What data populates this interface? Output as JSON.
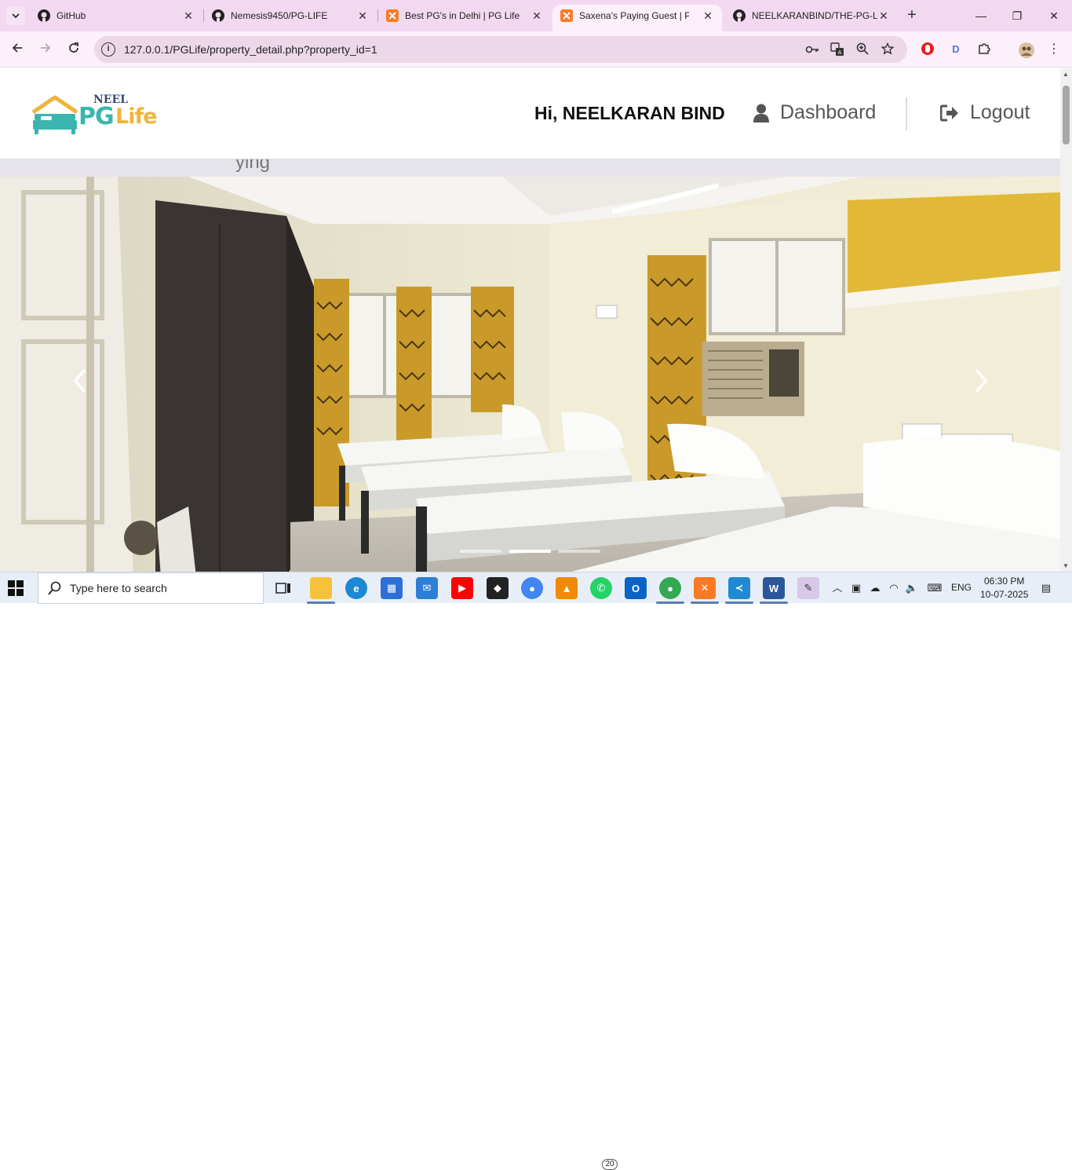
{
  "browser": {
    "tabs": [
      {
        "title": "GitHub",
        "favicon": "github-icon",
        "active": false
      },
      {
        "title": "Nemesis9450/PG-LIFE",
        "favicon": "github-icon",
        "active": false
      },
      {
        "title": "Best PG's in Delhi | PG Life",
        "favicon": "xampp-icon",
        "active": false
      },
      {
        "title": "Saxena's Paying Guest | PG Life",
        "favicon": "xampp-icon",
        "active": true
      },
      {
        "title": "NEELKARANBIND/THE-PG-LIFE",
        "favicon": "github-icon",
        "active": false
      }
    ],
    "url": "127.0.0.1/PGLife/property_detail.php?property_id=1"
  },
  "site": {
    "logo": {
      "top_text": "NEEL",
      "main_left": "PG",
      "main_right": "Life"
    },
    "greeting": "Hi, NEELKARAN BIND",
    "nav": {
      "dashboard": "Dashboard",
      "logout": "Logout"
    },
    "subtitle_fragment": "ying"
  },
  "carousel": {
    "slide_count": 3,
    "active_index": 1,
    "prev_label": "Previous",
    "next_label": "Next"
  },
  "taskbar": {
    "search_placeholder": "Type here to search",
    "whatsapp_badge": "20",
    "language": "ENG",
    "time": "06:30 PM",
    "date": "10-07-2025"
  },
  "colors": {
    "tabstrip": "#f3d9f0",
    "toolbar": "#fcf0fa",
    "logo_teal": "#3bb5b0",
    "logo_yellow": "#f0b43c",
    "logo_navy": "#3a4a7a"
  }
}
